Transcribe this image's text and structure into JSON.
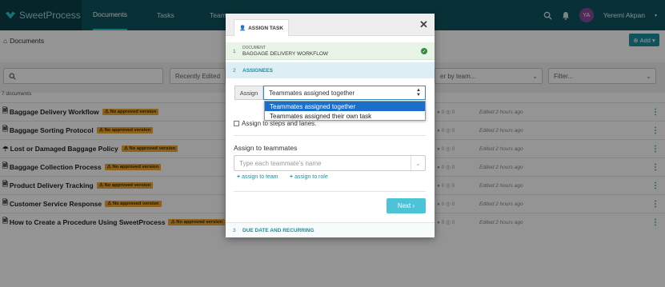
{
  "app": {
    "logo": "SweetProcess"
  },
  "nav": {
    "documents": "Documents",
    "tasks": "Tasks",
    "teams": "Team"
  },
  "user": {
    "initials": "YA",
    "name": "Yeremi Akpan"
  },
  "breadcrumb": "Documents",
  "add_button": "Add",
  "filters": {
    "recently_edited": "Recently Edited",
    "by_team": "er by team...",
    "filter": "Filter..."
  },
  "doc_count": "7 documents",
  "documents": [
    {
      "title": "Baggage Delivery Workflow",
      "badge": "No approved version",
      "meta": "● 0 ◎ 0",
      "edited": "Edited 2 hours ago"
    },
    {
      "title": "Baggage Sorting Protocol",
      "badge": "No approved version",
      "meta": "● 0 ◎ 0",
      "edited": "Edited 2 hours ago"
    },
    {
      "title": "Lost or Damaged Baggage Policy",
      "badge": "No approved version",
      "meta": "● 0 ◎ 0",
      "edited": "Edited 2 hours ago"
    },
    {
      "title": "Baggage Collection Process",
      "badge": "No approved version",
      "meta": "● 0 ◎ 0",
      "edited": "Edited 2 hours ago"
    },
    {
      "title": "Product Delivery Tracking",
      "badge": "No approved version",
      "meta": "● 0 ◎ 0",
      "edited": "Edited 2 hours ago"
    },
    {
      "title": "Customer Service Response",
      "badge": "No approved version",
      "meta": "● 0 ◎ 0",
      "edited": "Edited 2 hours ago"
    },
    {
      "title": "How to Create a Procedure Using SweetProcess",
      "badge": "No approved version",
      "meta": "● 0 ◎ 0",
      "edited": "Edited 2 hours ago"
    }
  ],
  "modal": {
    "tab": "ASSIGN TASK",
    "close": "✕",
    "step1": {
      "num": "1",
      "label": "DOCUMENT",
      "value": "BAGGAGE DELIVERY WORKFLOW"
    },
    "step2": {
      "num": "2",
      "label": "ASSIGNEES"
    },
    "assign_label": "Assign",
    "assign_value": "Teammates assigned together",
    "options": [
      "Teammates assigned together",
      "Teammates assigned their own task"
    ],
    "steps_checkbox": "Assign to steps and lanes.",
    "teammates_label": "Assign to teammates",
    "teammates_placeholder": "Type each teammate's name",
    "assign_team": "assign to team",
    "assign_role": "assign to role",
    "next": "Next",
    "step3": {
      "num": "3",
      "label": "DUE DATE AND RECURRING"
    }
  }
}
